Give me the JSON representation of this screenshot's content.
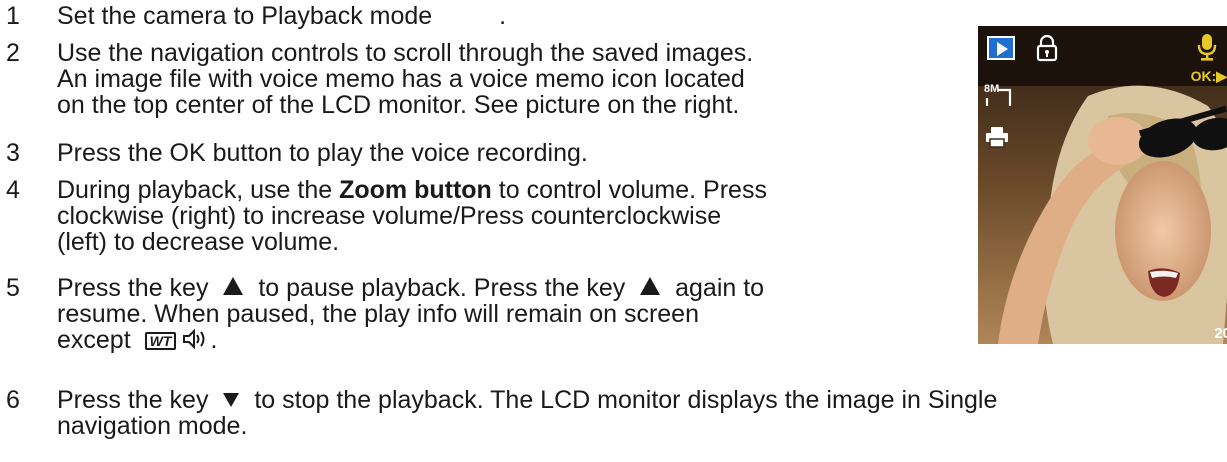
{
  "steps": [
    {
      "num": "1",
      "lines": [
        "Set the camera to Playback mode ",
        "."
      ]
    },
    {
      "num": "2",
      "lines": [
        "Use the navigation controls to scroll through the saved images.",
        "An image file with voice memo has a voice memo icon located",
        "on the top center of the LCD monitor. See picture on the right."
      ]
    },
    {
      "num": "3",
      "lines": [
        "Press the OK button to play the voice recording."
      ]
    },
    {
      "num": "4",
      "line1_pre": "During playback, use the ",
      "line1_bold": "Zoom button",
      "line1_post": " to control volume. Press",
      "lines": [
        "clockwise (right) to increase volume/Press counterclockwise",
        "(left) to decrease volume."
      ]
    },
    {
      "num": "5",
      "line1_a": "Press the key ",
      "line1_b": " to pause playback. Press the key ",
      "line1_c": " again to",
      "lines": [
        "resume. When paused, the play info will remain on screen"
      ],
      "line3_pre": "except",
      "line3_post": "."
    },
    {
      "num": "6",
      "line1_a": "Press the key ",
      "line1_b": " to stop the playback. The LCD monitor displays the image in Single",
      "lines": [
        "navigation mode."
      ]
    }
  ],
  "icons": {
    "wt": "WT",
    "speaker": "speaker-icon",
    "up": "up-arrow-key-icon",
    "down": "down-arrow-key-icon"
  },
  "lcd": {
    "ok_label": "OK:▶",
    "resolution_label": "8M",
    "date_partial": "20"
  }
}
